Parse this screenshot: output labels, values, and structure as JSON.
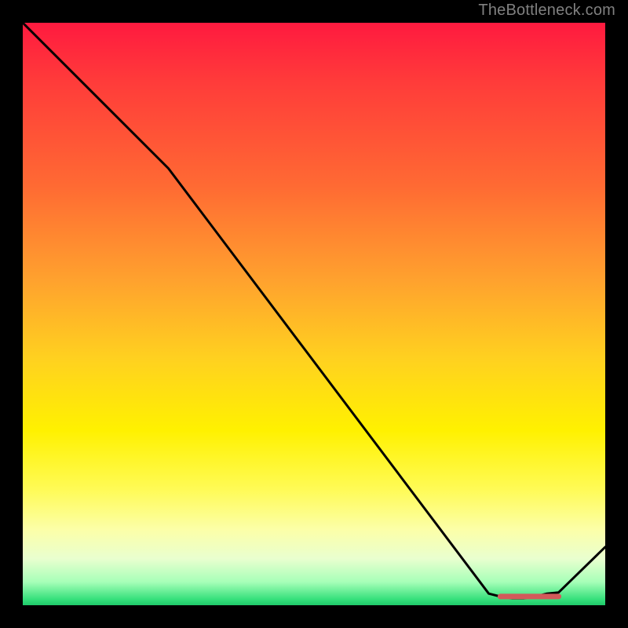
{
  "watermark": "TheBottleneck.com",
  "chart_data": {
    "type": "line",
    "title": "",
    "xlabel": "",
    "ylabel": "",
    "xlim": [
      0,
      100
    ],
    "ylim": [
      0,
      100
    ],
    "grid": false,
    "series": [
      {
        "name": "curve",
        "x": [
          0,
          25,
          80,
          82,
          84,
          86,
          88,
          90,
          92,
          100
        ],
        "values": [
          100,
          75,
          2,
          1.5,
          1.2,
          1.2,
          1.5,
          2,
          2.2,
          10
        ]
      }
    ],
    "annotations": [
      {
        "type": "overlay-band",
        "xmin": 82,
        "xmax": 92,
        "y": 1.5,
        "color": "#d25a5a"
      }
    ]
  }
}
